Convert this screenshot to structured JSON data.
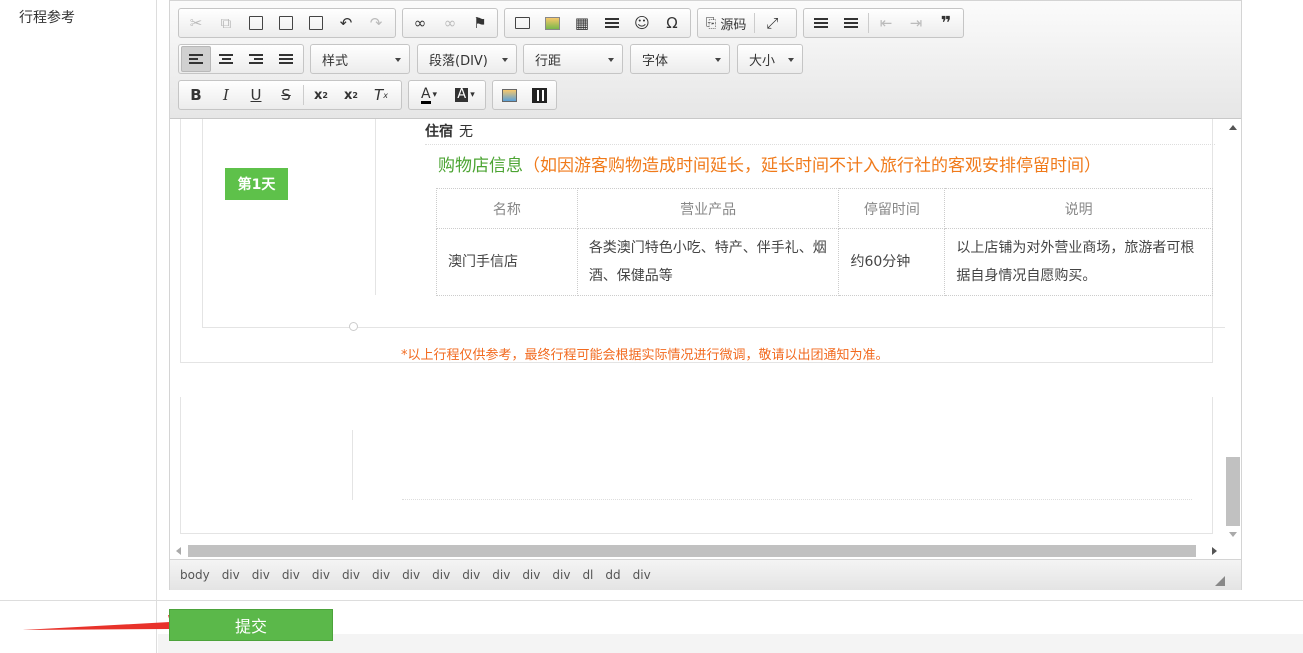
{
  "field_label": "行程参考",
  "toolbar": {
    "style_select": "样式",
    "paragraph_select": "段落(DIV)",
    "line_height_select": "行距",
    "font_select": "字体",
    "size_select": "大小",
    "source_label": "源码"
  },
  "content": {
    "day_tag": "第1天",
    "stay_label": "住宿",
    "stay_value": "无",
    "shop_title_main": "购物店信息",
    "shop_title_note": "（如因游客购物造成时间延长，延长时间不计入旅行社的客观安排停留时间）",
    "table_headers": [
      "名称",
      "营业产品",
      "停留时间",
      "说明"
    ],
    "table_rows": [
      [
        "澳门手信店",
        "各类澳门特色小吃、特产、伴手礼、烟酒、保健品等",
        "约60分钟",
        "以上店铺为对外营业商场，旅游者可根据自身情况自愿购买。"
      ]
    ],
    "disclaimer": "*以上行程仅供参考，最终行程可能会根据实际情况进行微调，敬请以出团通知为准。"
  },
  "statusbar": {
    "path": [
      "body",
      "div",
      "div",
      "div",
      "div",
      "div",
      "div",
      "div",
      "div",
      "div",
      "div",
      "div",
      "div",
      "dl",
      "dd",
      "div"
    ]
  },
  "submit_label": "提交",
  "colors": {
    "green": "#5ec14a",
    "orange": "#f07a1a",
    "submit": "#5bb84a",
    "arrow": "#e8322a"
  }
}
